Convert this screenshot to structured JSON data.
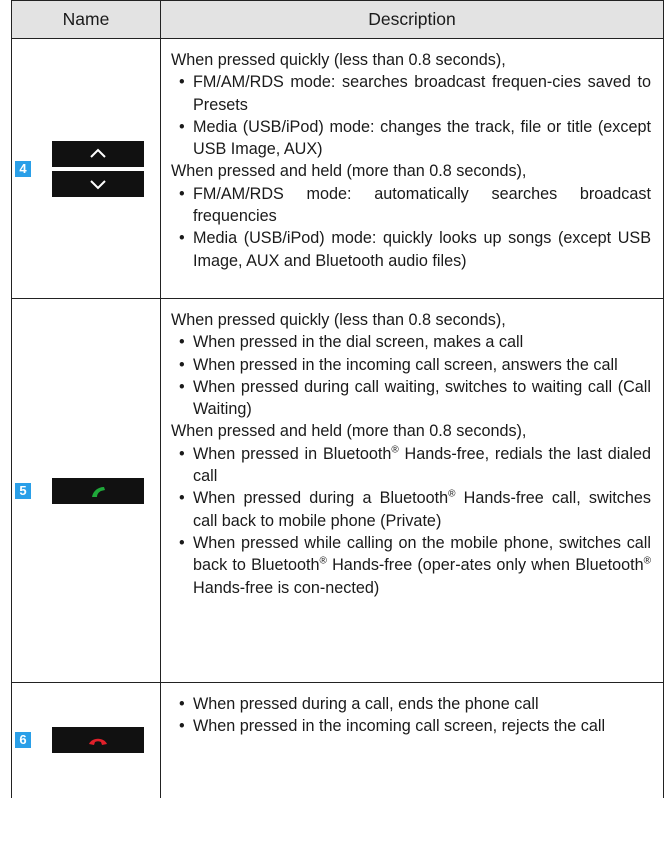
{
  "header": {
    "name": "Name",
    "description": "Description"
  },
  "rows": [
    {
      "number": "4",
      "blocks": [
        {
          "type": "p",
          "text": "When pressed quickly (less than 0.8 seconds),"
        },
        {
          "type": "ul",
          "items": [
            "FM/AM/RDS mode: searches broadcast frequen-cies saved to Presets",
            "Media (USB/iPod) mode: changes the track, file or title (except USB Image, AUX)"
          ]
        },
        {
          "type": "p",
          "text": "When pressed and held (more than 0.8 seconds),"
        },
        {
          "type": "ul",
          "items": [
            "FM/AM/RDS mode: automatically searches broadcast frequencies",
            "Media (USB/iPod) mode: quickly looks up songs (except USB Image, AUX and Bluetooth audio files)"
          ]
        }
      ]
    },
    {
      "number": "5",
      "blocks": [
        {
          "type": "p",
          "text": "When pressed quickly (less than 0.8 seconds),"
        },
        {
          "type": "ul",
          "items": [
            "When pressed in the dial screen, makes a call",
            "When pressed in the incoming call screen, answers the call",
            "When pressed during call waiting, switches to waiting call (Call Waiting)"
          ]
        },
        {
          "type": "p",
          "text": "When pressed and held (more than 0.8 seconds),"
        },
        {
          "type": "ul",
          "items": [
            "When pressed in Bluetooth® Hands-free, redials the last dialed call",
            "When pressed during a Bluetooth® Hands-free call, switches call back to mobile phone (Private)",
            "When pressed while calling on the mobile phone, switches call back to Bluetooth® Hands-free (oper-ates only when Bluetooth® Hands-free is con-nected)"
          ]
        }
      ]
    },
    {
      "number": "6",
      "blocks": [
        {
          "type": "ul",
          "items": [
            "When pressed during a call, ends the phone call",
            "When pressed in the incoming call screen, rejects the call"
          ]
        }
      ]
    }
  ],
  "icons": {
    "row4": [
      "chevron-up-icon",
      "chevron-down-icon"
    ],
    "row5": "call-answer-icon",
    "row6": "call-end-icon"
  },
  "colors": {
    "badge": "#2a9fe8",
    "header_bg": "#e3e3e3",
    "call_green": "#1fa83a",
    "call_red": "#e0202a"
  }
}
